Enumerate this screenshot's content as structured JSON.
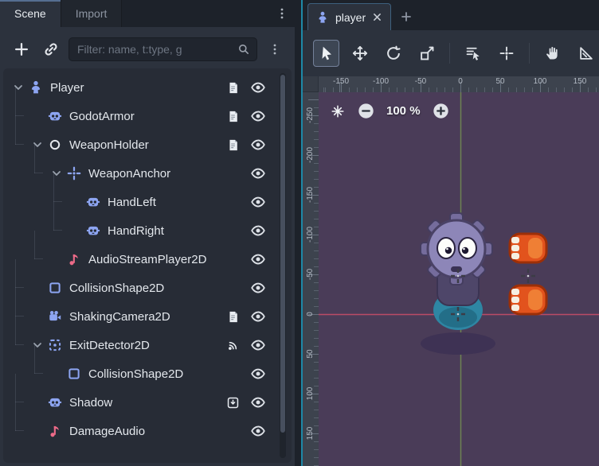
{
  "left_dock": {
    "tabs": {
      "scene": "Scene",
      "import": "Import"
    },
    "toolbar": {
      "filter_placeholder": "Filter: name, t:type, g",
      "icons": [
        "add-node",
        "instance-scene",
        "search",
        "menu"
      ]
    },
    "tree": {
      "nodes": [
        {
          "name": "Player",
          "type": "character-body-2d",
          "depth": 0,
          "expanded": true,
          "badges": [
            "script",
            "visibility"
          ]
        },
        {
          "name": "GodotArmor",
          "type": "sprite-2d",
          "depth": 1,
          "expanded": false,
          "badges": [
            "script",
            "visibility"
          ]
        },
        {
          "name": "WeaponHolder",
          "type": "node",
          "depth": 1,
          "expanded": true,
          "badges": [
            "script",
            "visibility"
          ]
        },
        {
          "name": "WeaponAnchor",
          "type": "marker-2d",
          "depth": 2,
          "expanded": true,
          "badges": [
            "visibility"
          ]
        },
        {
          "name": "HandLeft",
          "type": "sprite-2d",
          "depth": 3,
          "expanded": false,
          "badges": [
            "visibility"
          ]
        },
        {
          "name": "HandRight",
          "type": "sprite-2d",
          "depth": 3,
          "expanded": false,
          "badges": [
            "visibility"
          ]
        },
        {
          "name": "AudioStreamPlayer2D",
          "type": "audio-stream-player-2d",
          "depth": 2,
          "expanded": false,
          "badges": [
            "visibility"
          ]
        },
        {
          "name": "CollisionShape2D",
          "type": "collision-shape-2d",
          "depth": 1,
          "expanded": false,
          "badges": [
            "visibility"
          ]
        },
        {
          "name": "ShakingCamera2D",
          "type": "camera-2d",
          "depth": 1,
          "expanded": false,
          "badges": [
            "script",
            "visibility"
          ]
        },
        {
          "name": "ExitDetector2D",
          "type": "area-2d",
          "depth": 1,
          "expanded": true,
          "badges": [
            "signal",
            "visibility"
          ]
        },
        {
          "name": "CollisionShape2D",
          "type": "collision-shape-2d",
          "depth": 2,
          "expanded": false,
          "badges": [
            "visibility"
          ]
        },
        {
          "name": "Shadow",
          "type": "sprite-2d",
          "depth": 1,
          "expanded": false,
          "badges": [
            "group",
            "visibility"
          ]
        },
        {
          "name": "DamageAudio",
          "type": "audio-stream-player-2d",
          "depth": 1,
          "expanded": false,
          "badges": [
            "visibility"
          ]
        }
      ]
    }
  },
  "viewport": {
    "tab": {
      "label": "player",
      "icon": "character-body-2d"
    },
    "tools": [
      "select",
      "move",
      "rotate",
      "scale",
      "list-select",
      "snap",
      "pan",
      "ruler"
    ],
    "zoom": {
      "value": "100 %"
    },
    "rulers": {
      "h": [
        "-150",
        "-100",
        "-50",
        "0",
        "50",
        "100",
        "150"
      ],
      "v": [
        "-250",
        "-200",
        "-150",
        "-100",
        "-50",
        "0",
        "50",
        "100",
        "150"
      ]
    }
  },
  "colors": {
    "canvas_bg": "#4a3c58",
    "axis_x_red": "#e0506b",
    "axis_y_green": "#8cbe50",
    "splitter_accent": "#1e89a7",
    "node_2d_blue": "#8da5f2",
    "audio_pink": "#ec6a88"
  }
}
